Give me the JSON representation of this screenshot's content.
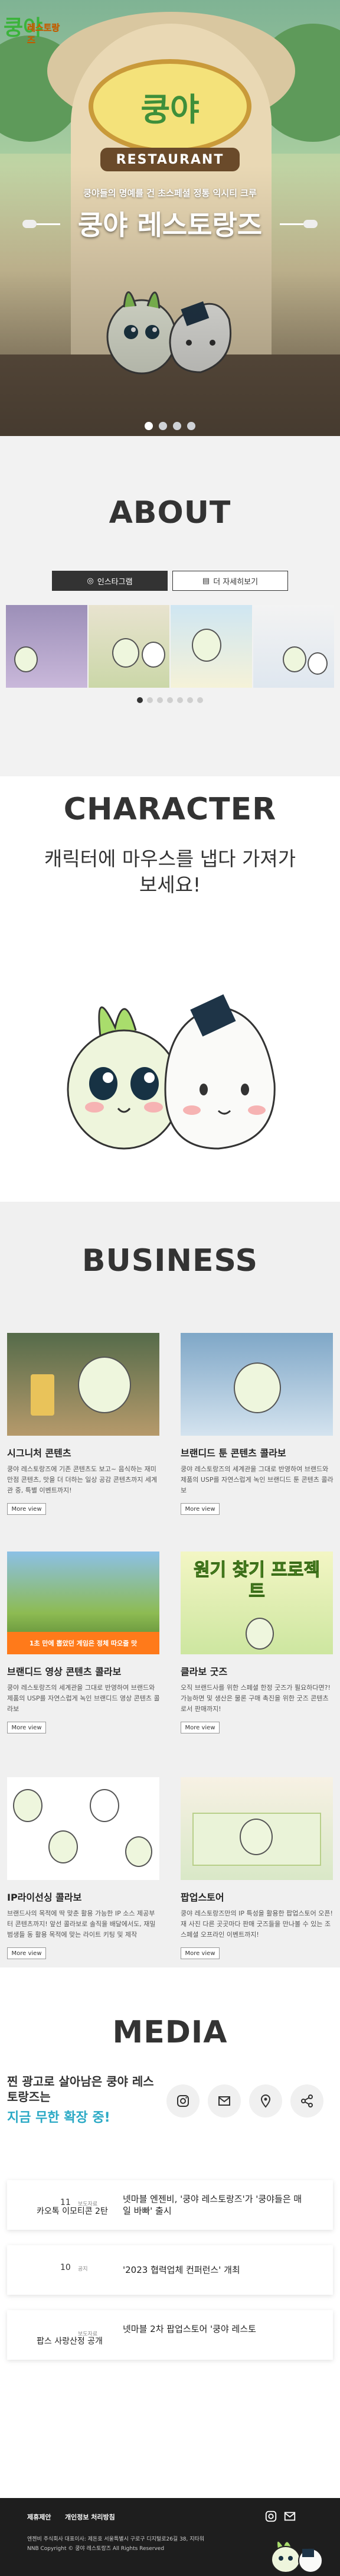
{
  "hero": {
    "logo_main": "쿵야",
    "logo_sub": "레스토랑즈",
    "sign_text": "쿵야",
    "banner_text": "RESTAURANT",
    "subtitle": "쿵야들의 명예를 건 초스페셜 정통 익시티 크루",
    "title": "쿵야 레스토랑즈",
    "slides": 4
  },
  "about": {
    "title": "ABOUT",
    "insta_button": "인스타그램",
    "more_button": "더 자세히보기",
    "carousel_pages": 7
  },
  "character": {
    "title": "CHARACTER",
    "subtitle": "캐릭터에 마우스를 냅다 가져가 보세요!"
  },
  "business": {
    "title": "BUSINESS",
    "items": [
      {
        "title": "시그니처 콘텐츠",
        "desc": "쿵야 레스토랑즈에 기존 콘텐츠도 보고~ 음식하는 재미만점 콘텐츠, 맛을 더 더하는 일상 공감 콘텐츠까지 세계관 중, 특별 이벤트까지!",
        "more": "More view"
      },
      {
        "title": "브랜디드 툰 콘텐츠 콜라보",
        "desc": "쿵야 레스토랑즈의 세계관을 그대로 반영하여 브랜드와 제품의 USP를 자연스럽게 녹인 브랜디드 툰 콘텐츠 콜라보",
        "more": "More view"
      },
      {
        "title": "브랜디드 영상 콘텐츠 콜라보",
        "desc": "쿵야 레스토랑즈의 세계관을 그대로 반영하여 브랜드와 제품의 USP를 자연스럽게 녹인 브랜디드 영상 콘텐츠 콜라보",
        "more": "More view"
      },
      {
        "title": "클라보 굿즈",
        "desc": "오직 브랜드사를 위한 스페셜 한정 굿즈가 필요하다면?! 가능하면 및 생산은 물론 구매 촉진을 위한 굿즈 콘텐츠로서 판매까지!",
        "more": "More view"
      },
      {
        "title": "IP라이선싱 콜라보",
        "desc": "브랜드사의 목적에 딱 맞춘 활용 가능한 IP 소스 제공부터 콘텐츠까지! 앞선 콜라보로 솔직을 배달에서도, 재밀 범생들 동 활용 목적에 맞는 라이트 키팅 및 제작",
        "more": "More view"
      },
      {
        "title": "팝업스토어",
        "desc": "쿵야 레스토랑즈만의 IP 특성을 활용한 팝업스토어 오픈! 재 사진 다른 곳곳마다 판매 굿즈들을 만나볼 수 있는 조스페셜 오프라인 이벤트까지!",
        "more": "More view"
      }
    ],
    "badge_text": "1초 만에 뽑아버리는 맛 토막이",
    "badge_sub": "1초 만에 뽑았던 게임은 정체 따오줄 맛",
    "popup_text": "원기 찾기 프로젝트"
  },
  "media": {
    "title": "MEDIA",
    "headline1": "찐 광고로 살아남은 쿵야 레스토랑즈는",
    "headline2": "지금 무한 확장 중!",
    "sns_icons": [
      "instagram-icon",
      "mail-icon",
      "location-icon",
      "share-icon"
    ],
    "news": [
      {
        "num": "11",
        "cat": "보도자료",
        "left": "카오톡 이모티콘 2탄",
        "title": "넷마블 엔젠비, '쿵야 레스토랑즈'가 '쿵야들은 매일 바빠' 출시"
      },
      {
        "num": "10",
        "cat": "공지",
        "left": "",
        "title": "'2023 협력업체 컨퍼런스' 개최"
      },
      {
        "num": "",
        "cat": "보도자료",
        "left": "팝스 사랑산정 공개",
        "title": "넷마블 2차 팝업스토어 '쿵야 레스토"
      }
    ]
  },
  "footer": {
    "link1": "제휴제안",
    "link2": "개인정보 처리방침",
    "info1": "엔젠비 주식회사    대표이사: 제돈호    서울특별시 구로구 디지털로26길 38, 지타워",
    "info2": "NNB Copyright © 쿵야 레스토랑즈 All Rights Reserved"
  },
  "colors": {
    "accent": "#2aa9c5",
    "dark": "#333333",
    "footer": "#1e1e1e"
  }
}
